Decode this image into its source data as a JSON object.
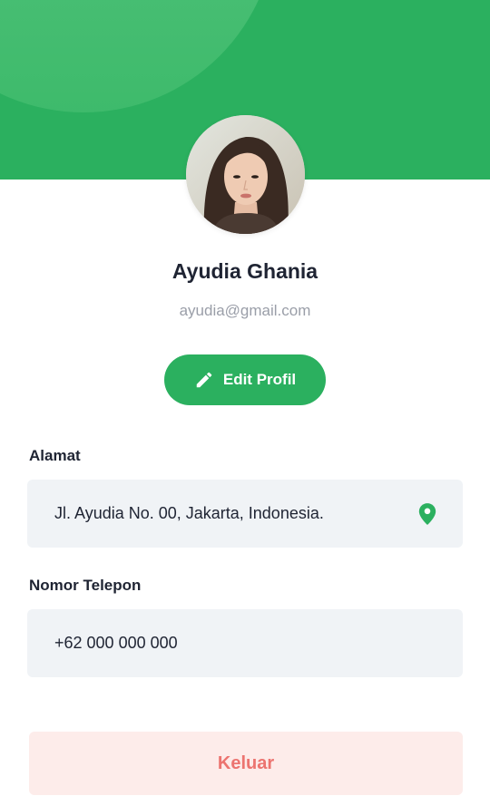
{
  "profile": {
    "name": "Ayudia Ghania",
    "email": "ayudia@gmail.com"
  },
  "actions": {
    "edit_label": "Edit Profil",
    "logout_label": "Keluar"
  },
  "fields": {
    "address": {
      "label": "Alamat",
      "value": "Jl. Ayudia No. 00, Jakarta, Indonesia."
    },
    "phone": {
      "label": "Nomor Telepon",
      "value": "+62 000 000 000"
    }
  },
  "icons": {
    "edit": "pencil-icon",
    "location": "map-pin-icon"
  },
  "colors": {
    "primary": "#2bb05f",
    "danger_text": "#ec7470",
    "danger_bg": "#fdecea",
    "field_bg": "#f0f3f6"
  }
}
